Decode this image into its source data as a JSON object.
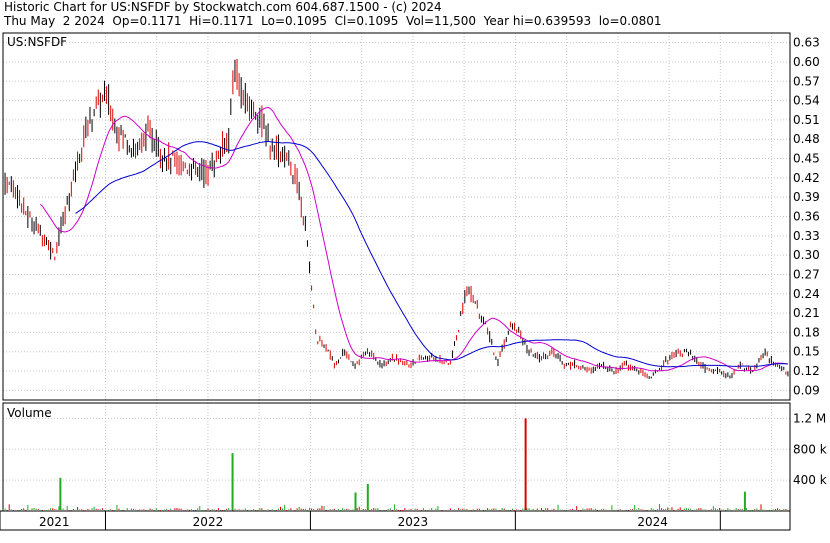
{
  "header": {
    "line1": "Historic Chart for US:NSFDF by Stockwatch.com 604.687.1500 - (c) 2024",
    "line2": "Thu May  2 2024  Op=0.1171  Hi=0.1171  Lo=0.1095  Cl=0.1095  Vol=11,500  Year hi=0.639593  lo=0.0801"
  },
  "chart_data": {
    "type": "candlestick",
    "symbol_label": "US:NSFDF",
    "volume_label": "Volume",
    "price_axis": {
      "ylim": [
        0.075,
        0.645
      ],
      "ticks": [
        "0.63",
        "0.60",
        "0.57",
        "0.54",
        "0.51",
        "0.48",
        "0.45",
        "0.42",
        "0.39",
        "0.36",
        "0.33",
        "0.30",
        "0.27",
        "0.24",
        "0.21",
        "0.18",
        "0.15",
        "0.12",
        "0.09"
      ],
      "grid": true
    },
    "volume_axis": {
      "ylim": [
        0,
        1400000
      ],
      "ticks": [
        "1.2 M",
        "800 k",
        "400 k"
      ],
      "tick_values": [
        1200000,
        800000,
        400000
      ]
    },
    "x_axis": {
      "range": [
        2021.0,
        2024.35
      ],
      "year_labels": [
        {
          "label": "2021",
          "center": 2020.5
        },
        {
          "label": "2022",
          "center": 2021.5
        },
        {
          "label": "2023",
          "center": 2022.5
        },
        {
          "label": "2024",
          "center": 2023.5
        }
      ],
      "year_boundaries": [
        2021.0,
        2022.0,
        2023.0,
        2024.0
      ],
      "year_label_centers": [
        2021.5,
        2022.5,
        2023.5,
        2024.18
      ]
    },
    "price_series_anchors": [
      [
        2020.55,
        0.41
      ],
      [
        2020.62,
        0.36
      ],
      [
        2020.7,
        0.33
      ],
      [
        2020.75,
        0.3
      ],
      [
        2020.8,
        0.36
      ],
      [
        2020.85,
        0.43
      ],
      [
        2020.9,
        0.49
      ],
      [
        2020.95,
        0.53
      ],
      [
        2021.0,
        0.55
      ],
      [
        2021.05,
        0.5
      ],
      [
        2021.1,
        0.48
      ],
      [
        2021.15,
        0.46
      ],
      [
        2021.2,
        0.49
      ],
      [
        2021.25,
        0.47
      ],
      [
        2021.3,
        0.45
      ],
      [
        2021.38,
        0.44
      ],
      [
        2021.45,
        0.43
      ],
      [
        2021.5,
        0.43
      ],
      [
        2021.56,
        0.46
      ],
      [
        2021.6,
        0.48
      ],
      [
        2021.63,
        0.6
      ],
      [
        2021.66,
        0.55
      ],
      [
        2021.7,
        0.53
      ],
      [
        2021.75,
        0.52
      ],
      [
        2021.8,
        0.47
      ],
      [
        2021.85,
        0.46
      ],
      [
        2021.88,
        0.45
      ],
      [
        2021.93,
        0.42
      ],
      [
        2021.97,
        0.36
      ],
      [
        2022.0,
        0.27
      ],
      [
        2022.03,
        0.17
      ],
      [
        2022.07,
        0.16
      ],
      [
        2022.12,
        0.13
      ],
      [
        2022.16,
        0.15
      ],
      [
        2022.22,
        0.13
      ],
      [
        2022.28,
        0.15
      ],
      [
        2022.35,
        0.13
      ],
      [
        2022.4,
        0.14
      ],
      [
        2022.48,
        0.13
      ],
      [
        2022.55,
        0.14
      ],
      [
        2022.62,
        0.14
      ],
      [
        2022.68,
        0.13
      ],
      [
        2022.72,
        0.18
      ],
      [
        2022.76,
        0.25
      ],
      [
        2022.8,
        0.23
      ],
      [
        2022.84,
        0.2
      ],
      [
        2022.88,
        0.17
      ],
      [
        2022.91,
        0.13
      ],
      [
        2022.94,
        0.16
      ],
      [
        2022.98,
        0.19
      ],
      [
        2023.02,
        0.18
      ],
      [
        2023.06,
        0.15
      ],
      [
        2023.12,
        0.14
      ],
      [
        2023.18,
        0.15
      ],
      [
        2023.24,
        0.13
      ],
      [
        2023.3,
        0.13
      ],
      [
        2023.36,
        0.12
      ],
      [
        2023.42,
        0.13
      ],
      [
        2023.48,
        0.12
      ],
      [
        2023.54,
        0.13
      ],
      [
        2023.6,
        0.12
      ],
      [
        2023.66,
        0.11
      ],
      [
        2023.72,
        0.13
      ],
      [
        2023.78,
        0.15
      ],
      [
        2023.84,
        0.15
      ],
      [
        2023.9,
        0.13
      ],
      [
        2023.95,
        0.12
      ],
      [
        2024.0,
        0.12
      ],
      [
        2024.05,
        0.11
      ],
      [
        2024.1,
        0.13
      ],
      [
        2024.16,
        0.12
      ],
      [
        2024.22,
        0.15
      ],
      [
        2024.26,
        0.13
      ],
      [
        2024.32,
        0.12
      ],
      [
        2024.34,
        0.11
      ]
    ],
    "volume_spikes": [
      {
        "x": 2020.78,
        "v": 430000,
        "color": "#22aa22"
      },
      {
        "x": 2021.62,
        "v": 750000,
        "color": "#22aa22"
      },
      {
        "x": 2022.22,
        "v": 240000,
        "color": "#22aa22"
      },
      {
        "x": 2022.28,
        "v": 350000,
        "color": "#22aa22"
      },
      {
        "x": 2023.05,
        "v": 1200000,
        "color": "#dd0000"
      },
      {
        "x": 2024.12,
        "v": 250000,
        "color": "#22aa22"
      }
    ]
  },
  "colors": {
    "up": "#000000",
    "down": "#dd0000",
    "ma_short": "#cc00cc",
    "ma_long": "#0000cc",
    "volume_up": "#22aa22",
    "volume_down": "#dd0000",
    "grid": "#c8c8c8"
  }
}
